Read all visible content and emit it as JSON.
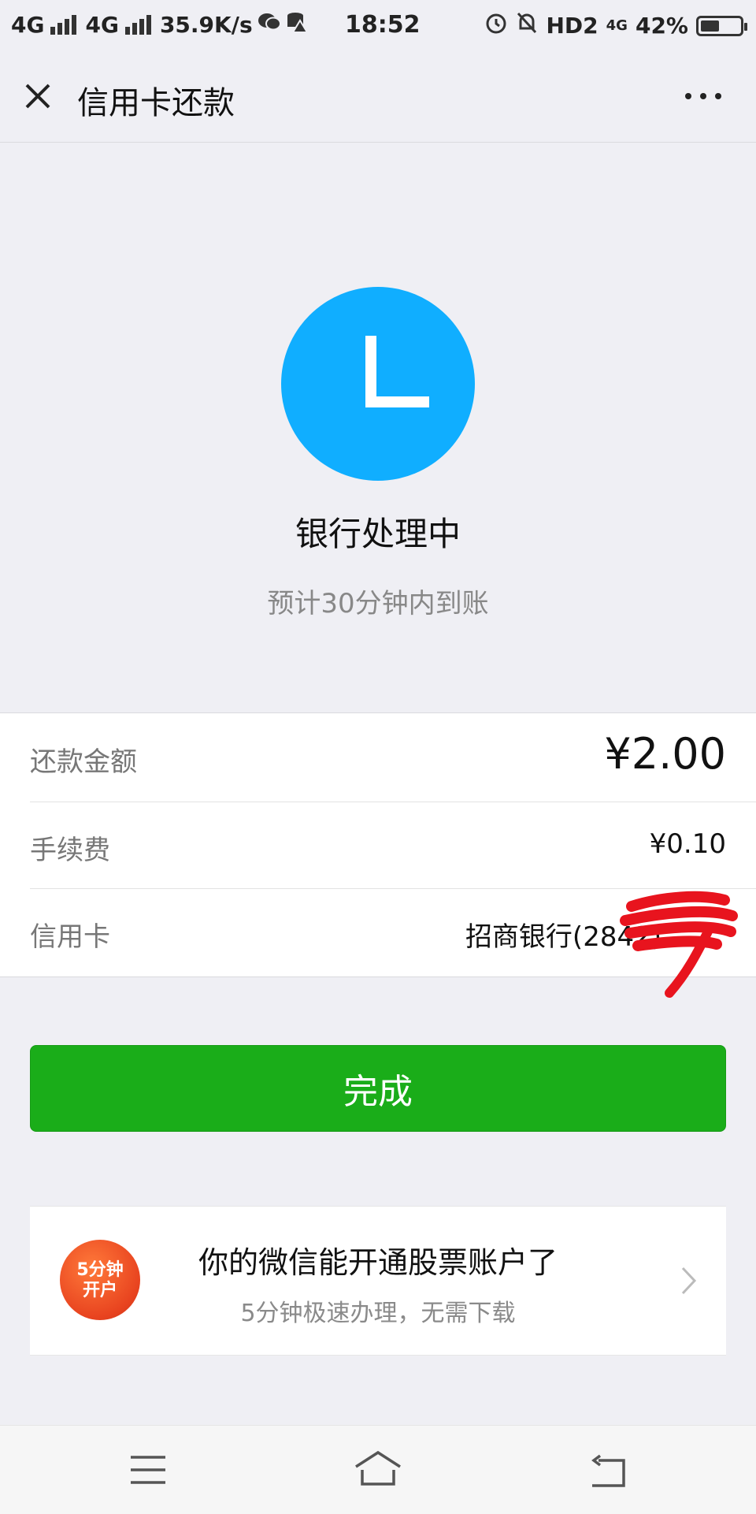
{
  "status_bar": {
    "network_left": "4G",
    "network_right": "4G",
    "speed": "35.9K/s",
    "time": "18:52",
    "hd": "HD2",
    "lte": "4G",
    "battery": "42%",
    "battery_level": 0.42
  },
  "header": {
    "title": "信用卡还款"
  },
  "status": {
    "icon_letter": "L",
    "title": "银行处理中",
    "subtitle": "预计30分钟内到账",
    "icon_color": "#10aeff"
  },
  "details": {
    "rows": [
      {
        "label": "还款金额",
        "value": "¥2.00"
      },
      {
        "label": "手续费",
        "value": "¥0.10"
      },
      {
        "label": "信用卡",
        "value": "招商银行(2842)"
      }
    ]
  },
  "actions": {
    "done_label": "完成",
    "done_color": "#1aad19"
  },
  "promo": {
    "badge_line1": "5分钟",
    "badge_line2": "开户",
    "title": "你的微信能开通股票账户了",
    "subtitle": "5分钟极速办理，无需下载"
  },
  "icons": {
    "close": "close-icon",
    "more": "more-icon",
    "chevron": "chevron-right-icon"
  }
}
